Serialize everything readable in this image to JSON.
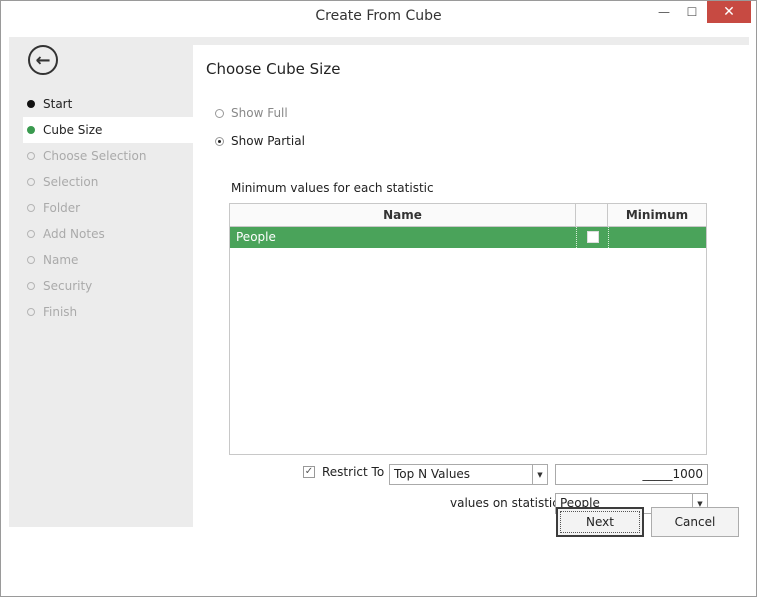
{
  "window": {
    "title": "Create From Cube",
    "minimize_glyph": "—",
    "maximize_glyph": "☐",
    "close_glyph": "✕"
  },
  "sidebar": {
    "back_icon": "arrow-left-circle-icon",
    "back_glyph": "←",
    "steps": [
      {
        "label": "Start",
        "state": "done"
      },
      {
        "label": "Cube Size",
        "state": "active"
      },
      {
        "label": "Choose Selection",
        "state": "todo"
      },
      {
        "label": "Selection",
        "state": "todo"
      },
      {
        "label": "Folder",
        "state": "todo"
      },
      {
        "label": "Add Notes",
        "state": "todo"
      },
      {
        "label": "Name",
        "state": "todo"
      },
      {
        "label": "Security",
        "state": "todo"
      },
      {
        "label": "Finish",
        "state": "todo"
      }
    ]
  },
  "main": {
    "heading": "Choose Cube Size",
    "radio_full": "Show Full",
    "radio_partial": "Show Partial",
    "selected_option": "Show Partial",
    "min_values_label": "Minimum values for each statistic",
    "grid": {
      "columns": [
        "Name",
        "",
        "Minimum"
      ],
      "rows": [
        {
          "name": "People",
          "checked": false,
          "minimum": ""
        }
      ]
    },
    "restrict_label": "Restrict To",
    "restrict_checked": true,
    "restrict_mode": "Top N Values",
    "n_value": "_____1000",
    "values_on_statistic_label": "values on statistic",
    "statistic": "People"
  },
  "buttons": {
    "next": "Next",
    "cancel": "Cancel"
  },
  "colors": {
    "selected_row": "#4aa35a",
    "active_step_dot": "#3a9a4f",
    "close_button": "#c74a42",
    "sidebar_bg": "#ececec"
  }
}
